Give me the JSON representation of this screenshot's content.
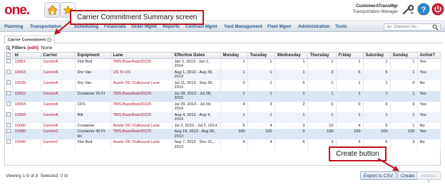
{
  "app": {
    "logo_text": "one",
    "user_name": "CustomerATransMgr",
    "user_role": "Transportation Manager",
    "brand_color": "#d0102a"
  },
  "nav": {
    "items": [
      "Planning",
      "Transportation",
      "Scheduling",
      "Financials",
      "Order Mgmt",
      "Reports",
      "Contract Mgmt",
      "Yard Management",
      "Fleet Mgmt",
      "Administration",
      "Tools"
    ],
    "search_placeholder": "by: Shipment No."
  },
  "tab": {
    "label": "Carrier Commitment"
  },
  "filters": {
    "label": "Filters",
    "edit": "(edit)",
    "value": ": None"
  },
  "table": {
    "columns": [
      "Id",
      "Carrier",
      "Equipment",
      "Lane",
      "Effective Dates",
      "Monday",
      "Tuesday",
      "Wednesday",
      "Thursday",
      "Friday",
      "Saturday",
      "Sunday",
      "Active?"
    ],
    "rows": [
      [
        "10061",
        "CarrierA",
        "Flat Bed",
        "TMS.BaseRate30229",
        "Jan 1, 2013 - Jan 1, 2014",
        "1",
        "1",
        "1",
        "1",
        "1",
        "1",
        "1",
        "Yes"
      ],
      [
        "10063",
        "CarrierA",
        "Dry Van",
        "US To US",
        "Aug 1, 2013 - Aug 30, 2013",
        "1",
        "1",
        "1",
        "3",
        "5",
        "5",
        "1",
        "Yes"
      ],
      [
        "10020",
        "CarrierA",
        "Dry Van",
        "Austin DC Outbound Lane",
        "Jul 11, 2013 - Sep 30, 2013",
        "0",
        "1",
        "5",
        "1",
        "1",
        "1",
        "0",
        "No"
      ],
      [
        "10062",
        "CarrierA",
        "Container 20 Ft",
        "TMS.BaseRate30229",
        "Jul 28, 2013 - Jul 28, 2015",
        "1",
        "1",
        "1",
        "1",
        "1",
        "1",
        "1",
        "Yes"
      ],
      [
        "10064",
        "CarrierA",
        "CFS",
        "TMS.BaseRate30229",
        "Jul 29, 2013 - Jul 29, 2014",
        "4",
        "3",
        "2",
        "0",
        "0",
        "0",
        "0",
        "Yes"
      ],
      [
        "10060",
        "CarrierA",
        "Rtk",
        "TMS.BaseRate30229",
        "Aug 4, 2013 - Aug 4, 2014",
        "1",
        "1",
        "1",
        "1",
        "1",
        "1",
        "1",
        "Yes"
      ],
      [
        "10000",
        "CarrierB",
        "Container",
        "Austin DC Outbound Lane",
        "Jul 2, 2013 - Jul 2, 2014",
        "5",
        "4",
        "3",
        "10",
        "4",
        "5",
        "1",
        "No"
      ],
      [
        "10080",
        "CarrierC",
        "Container 40 Ft Hc",
        "TMS.BaseRate30229",
        "Aug 19, 2013 - Aug 30, 2013",
        "100",
        "100",
        "0",
        "100",
        "100",
        "100",
        "100",
        "Yes"
      ],
      [
        "10040",
        "CarrierC",
        "Flat Bed",
        "Austin DC Outbound Lane",
        "Sep 7, 2013 - Dec 31, 2013",
        "4",
        "4",
        "6",
        "3",
        "5",
        "5",
        "3",
        "No"
      ]
    ]
  },
  "footer": {
    "viewing": "Viewing 1-9 of 9",
    "selected": "Selected: 0",
    "export_label": "Export to CSV",
    "create_label": "Create",
    "actions_label": "Actions"
  },
  "annotations": {
    "screen_title": "Carrier Commitment Summary screen",
    "create_callout": "Create button"
  }
}
